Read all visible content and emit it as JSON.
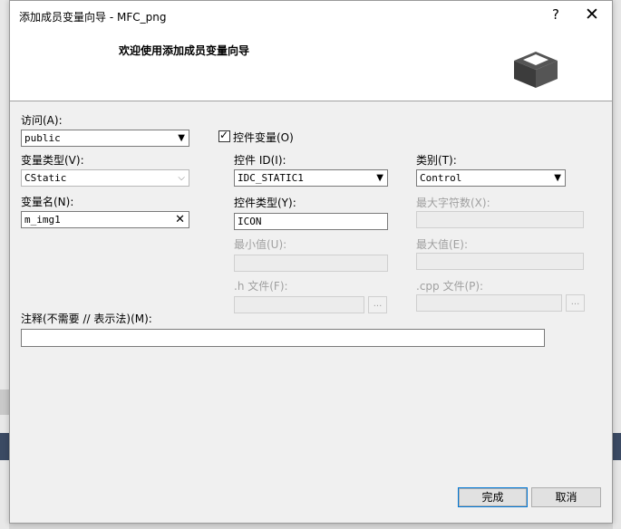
{
  "window": {
    "title": "添加成员变量向导 - MFC_png",
    "help_label": "?",
    "close_label": "✕"
  },
  "header": {
    "text": "欢迎使用添加成员变量向导",
    "icon": "box-icon"
  },
  "form": {
    "access_label": "访问(A):",
    "access_value": "public",
    "control_var_label": "控件变量(O)",
    "control_var_checked": true,
    "var_type_label": "变量类型(V):",
    "var_type_value": "CStatic",
    "control_id_label": "控件 ID(I):",
    "control_id_value": "IDC_STATIC1",
    "category_label": "类别(T):",
    "category_value": "Control",
    "var_name_label": "变量名(N):",
    "var_name_value": "m_img1",
    "control_type_label": "控件类型(Y):",
    "control_type_value": "ICON",
    "max_chars_label": "最大字符数(X):",
    "min_value_label": "最小值(U):",
    "max_value_label": "最大值(E):",
    "h_file_label": ".h 文件(F):",
    "cpp_file_label": ".cpp 文件(P):",
    "browse_label": "...",
    "comment_label": "注释(不需要 // 表示法)(M):",
    "comment_value": ""
  },
  "buttons": {
    "finish_label": "完成",
    "cancel_label": "取消"
  }
}
